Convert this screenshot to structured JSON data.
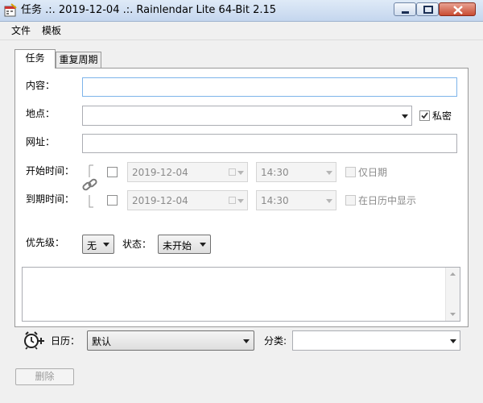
{
  "window": {
    "title": "任务 .:. 2019-12-04 .:. Rainlendar Lite 64-Bit 2.15"
  },
  "menu": {
    "items": [
      "文件",
      "模板"
    ]
  },
  "tabs": [
    {
      "label": "任务",
      "active": true
    },
    {
      "label": "重复周期",
      "active": false
    }
  ],
  "form": {
    "content_label": "内容：",
    "content_value": "",
    "location_label": "地点：",
    "location_value": "",
    "private_label": "私密",
    "private_checked": true,
    "url_label": "网址：",
    "url_value": "",
    "start_label": "开始时间：",
    "start_date": "2019-12-04",
    "start_time": "14:30",
    "start_checked": false,
    "date_only_label": "仅日期",
    "due_label": "到期时间：",
    "due_date": "2019-12-04",
    "due_time": "14:30",
    "due_checked": false,
    "show_in_calendar_label": "在日历中显示",
    "priority_label": "优先级：",
    "priority_value": "无",
    "status_label": "状态：",
    "status_value": "未开始",
    "notes_value": "",
    "calendar_label": "日历：",
    "calendar_value": "默认",
    "category_label": "分类:",
    "category_value": ""
  },
  "buttons": {
    "delete_label": "删除"
  },
  "icons": {
    "app": "calendar-app-icon",
    "link": "chain-link-icon",
    "alarm": "alarm-clock-add-icon"
  }
}
